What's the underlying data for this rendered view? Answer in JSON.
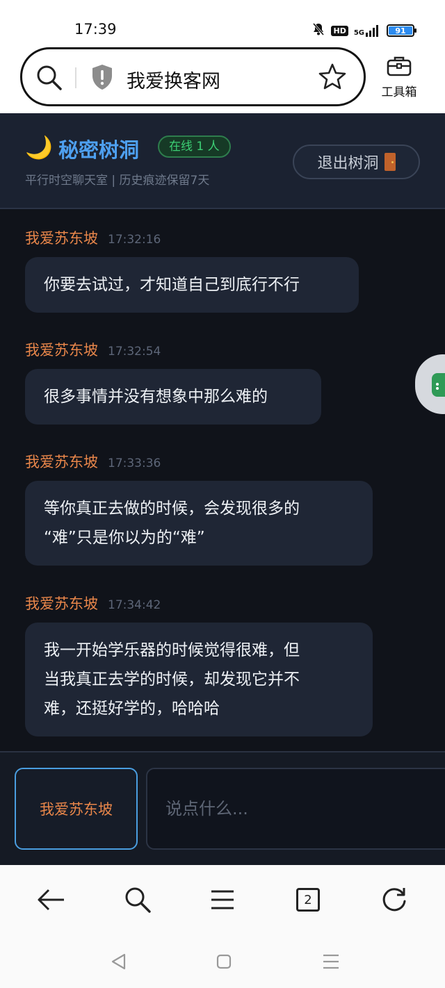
{
  "status_bar": {
    "time": "17:39",
    "network": "5G",
    "hd": "HD",
    "battery": "91",
    "icons": [
      "mute-bell-icon",
      "hd-icon",
      "signal-5g-icon",
      "battery-icon"
    ]
  },
  "browser": {
    "url_text": "我爱换客网",
    "toolbox_label": "工具箱",
    "tab_count": "2",
    "icons": [
      "search-icon",
      "shield-icon",
      "star-icon",
      "toolbox-icon",
      "back-arrow-icon",
      "menu-icon",
      "refresh-icon"
    ]
  },
  "room": {
    "moon": "🌙",
    "title": "秘密树洞",
    "online_badge": "在线 1 人",
    "subtitle": "平行时空聊天室 | 历史痕迹保留7天",
    "exit_label": "退出树洞"
  },
  "messages": [
    {
      "author": "我爱苏东坡",
      "time": "17:32:16",
      "lines": [
        "你要去试过，才知道自己到底行不行"
      ]
    },
    {
      "author": "我爱苏东坡",
      "time": "17:32:54",
      "lines": [
        "很多事情并没有想象中那么难的"
      ]
    },
    {
      "author": "我爱苏东坡",
      "time": "17:33:36",
      "lines": [
        "等你真正去做的时候，会发现很多的",
        "“难”只是你以为的“难”"
      ]
    },
    {
      "author": "我爱苏东坡",
      "time": "17:34:42",
      "lines": [
        "我一开始学乐器的时候觉得很难，但",
        "当我真正去学的时候，却发现它并不",
        "难，还挺好学的，哈哈哈"
      ]
    }
  ],
  "composer": {
    "nickname": "我爱苏东坡",
    "placeholder": "说点什么..."
  },
  "colors": {
    "accent_blue": "#4ea0f0",
    "author_orange": "#e8864a",
    "online_green": "#3ccf74",
    "app_bg": "#10131a",
    "bubble_bg": "#1f2635"
  }
}
